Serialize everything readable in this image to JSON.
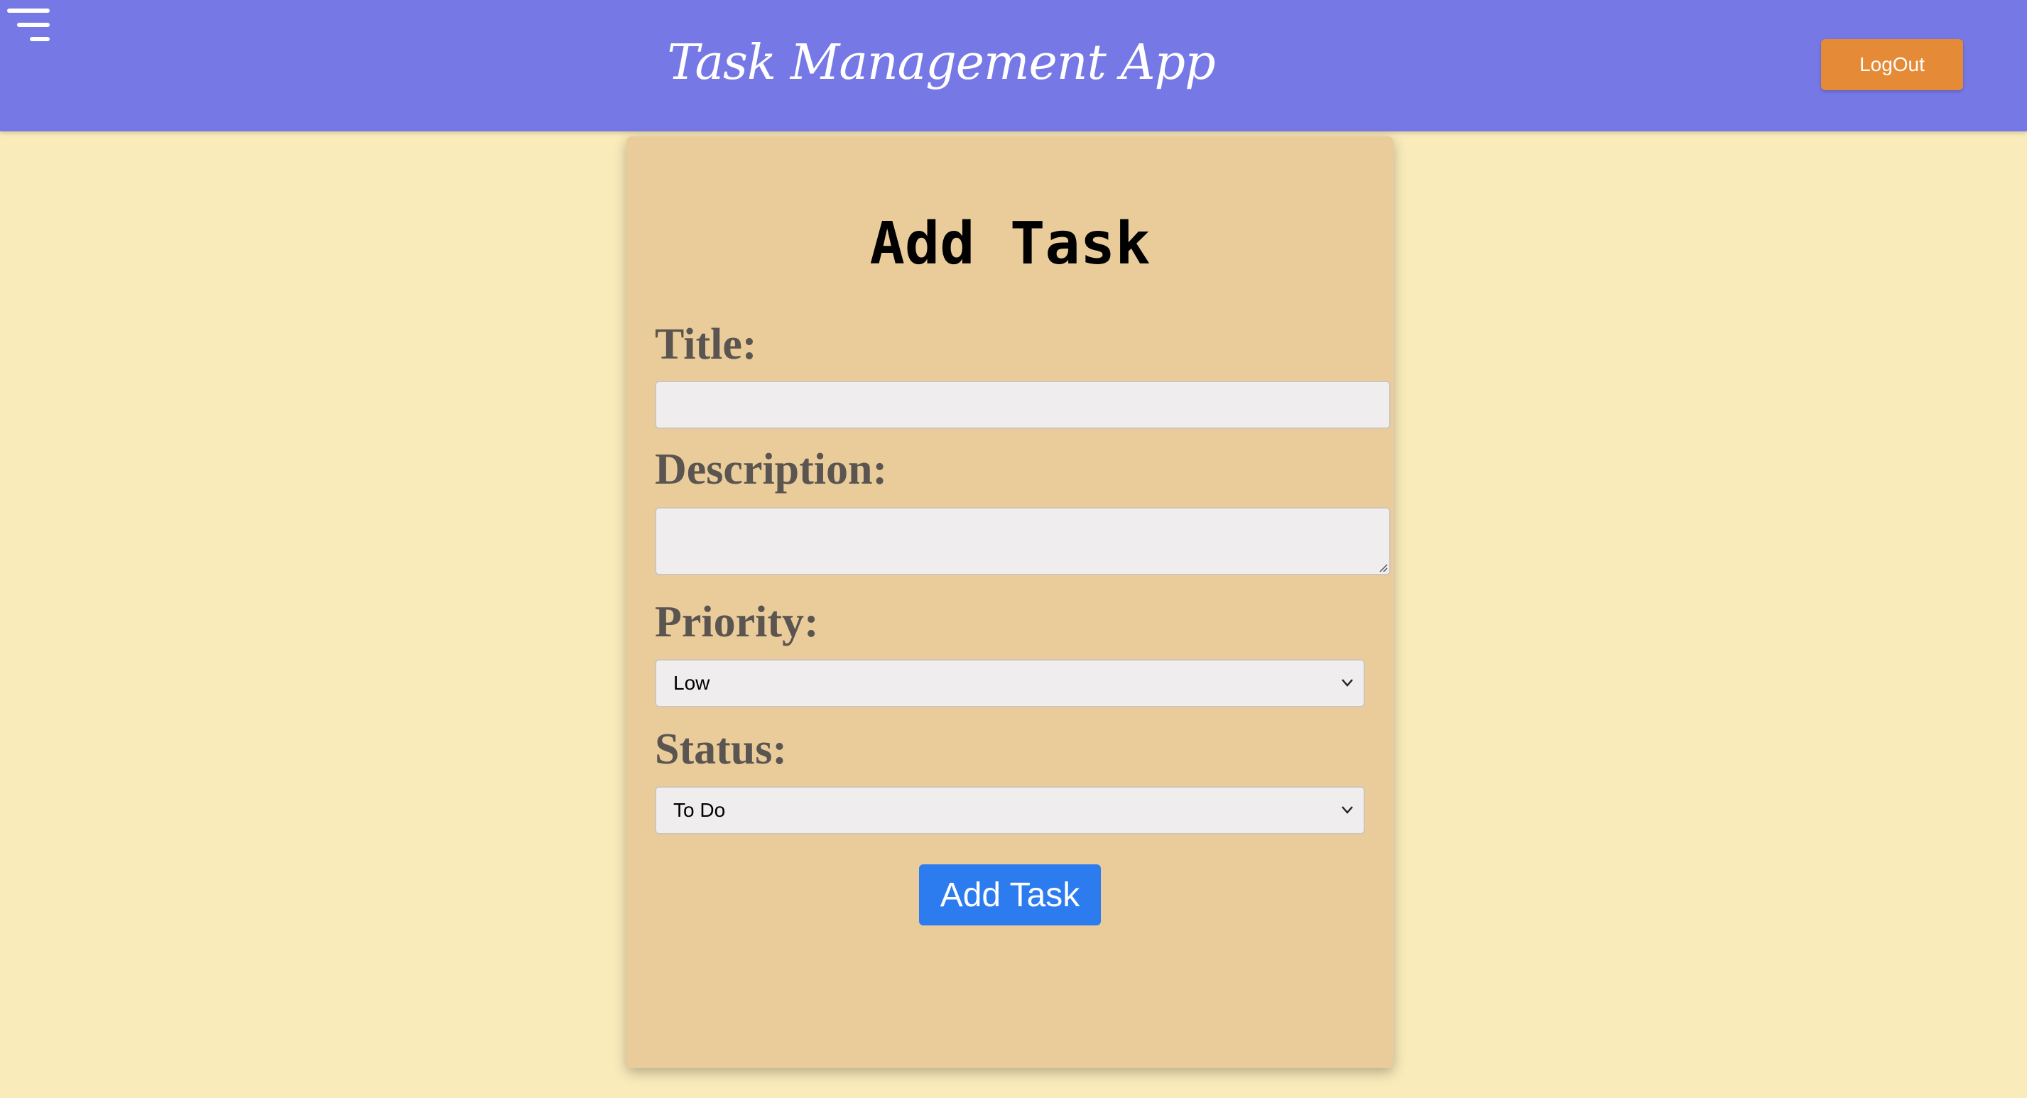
{
  "header": {
    "app_title": "Task Management App",
    "logout_label": "LogOut",
    "menu_icon": "hamburger-menu-icon"
  },
  "form": {
    "heading": "Add Task",
    "title_label": "Title:",
    "title_value": "",
    "description_label": "Description:",
    "description_value": "",
    "priority_label": "Priority:",
    "priority_selected": "Low",
    "status_label": "Status:",
    "status_selected": "To Do",
    "submit_label": "Add Task"
  },
  "colors": {
    "header_bg": "#7678e6",
    "page_bg": "#faebba",
    "card_bg": "#eacc9b",
    "logout_bg": "#e58a36",
    "submit_bg": "#2c7cf0"
  }
}
